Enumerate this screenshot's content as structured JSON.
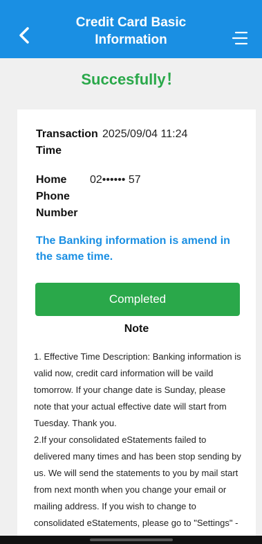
{
  "header": {
    "title": "Credit Card Basic Information",
    "back_icon": "chevron-left-icon",
    "menu_icon": "menu-icon",
    "color": "#1a8fe3"
  },
  "status": {
    "success_text": "Succesfully！",
    "color": "#2aa84a"
  },
  "details": {
    "transaction_time_label": "Transaction Time",
    "transaction_time_value": "2025/09/04 11:24",
    "home_phone_label": "Home Phone Number",
    "home_phone_value": "02•••••• 57"
  },
  "notice": "The Banking information is amend in the same time.",
  "completed_button": "Completed",
  "note": {
    "title": "Note",
    "item1": "1. Effective Time Description: Banking information is valid now, credit card information will be vaild tomorrow. If your change date is Sunday, please note that your actual effective date will start from Tuesday. Thank you.",
    "item2": "2.If your consolidated eStatements failed to delivered many times and has been stop sending by us. We will send the statements to you by mail start from next month when you change your email or mailing address. If you wish to change to consolidated eStatements, please go to \"Settings\" - eStatements Application"
  }
}
